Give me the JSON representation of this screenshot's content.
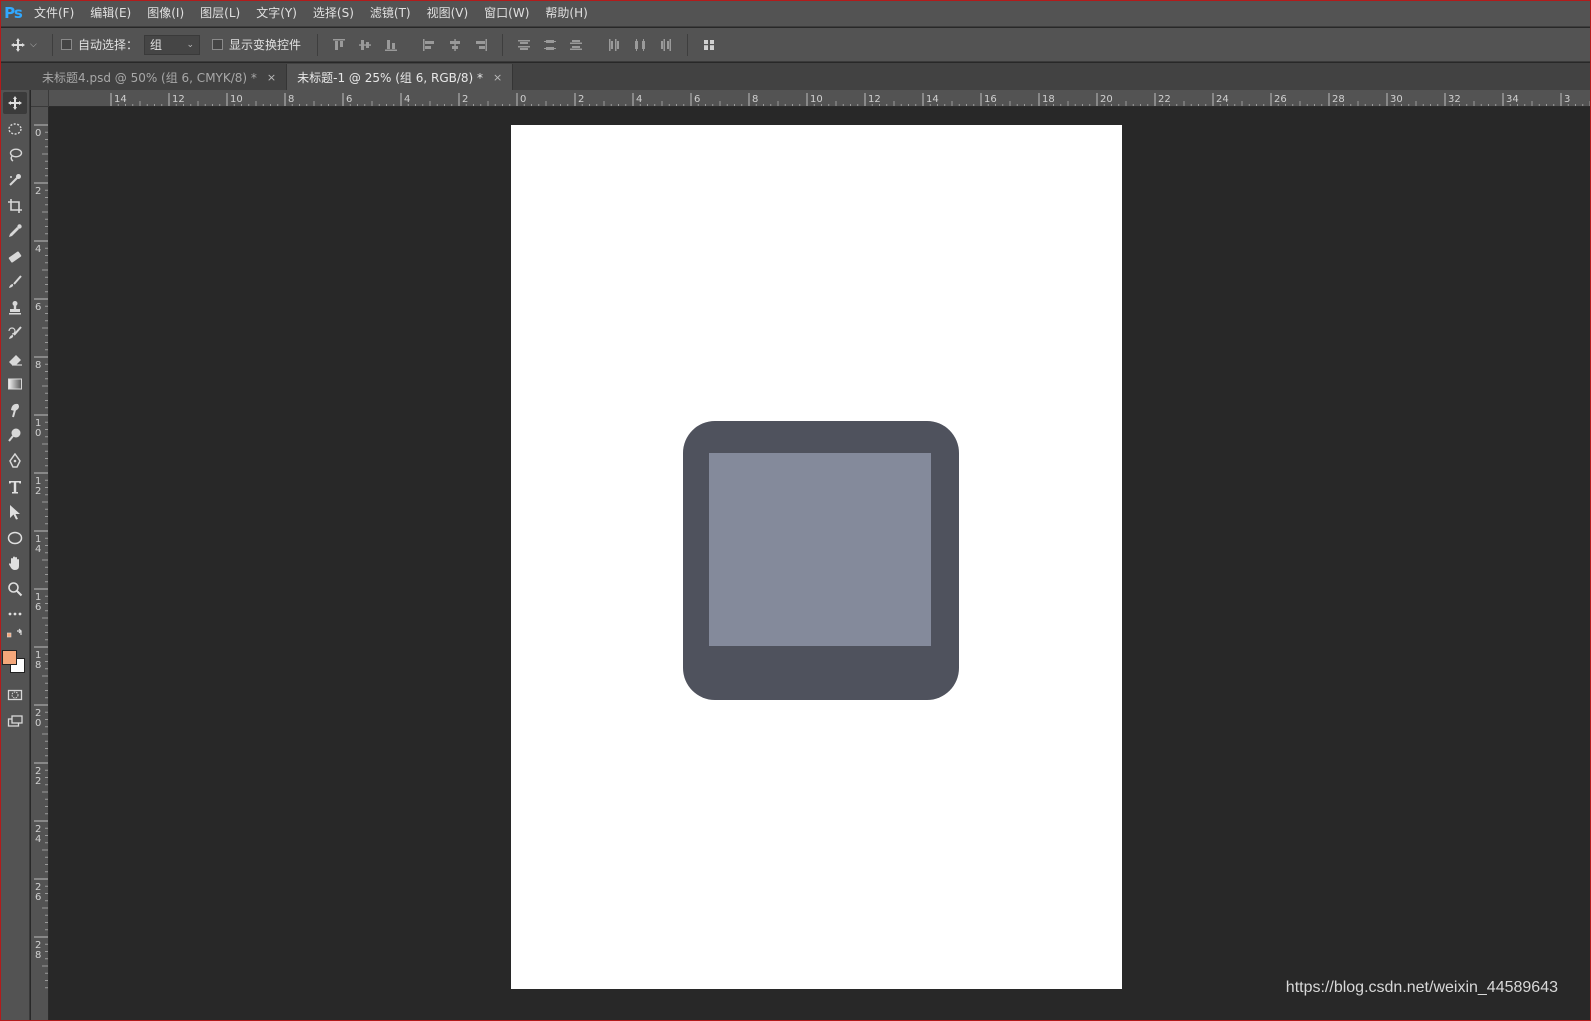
{
  "app": {
    "logo": "Ps"
  },
  "menu": [
    {
      "id": "file",
      "label": "文件(F)"
    },
    {
      "id": "edit",
      "label": "编辑(E)"
    },
    {
      "id": "image",
      "label": "图像(I)"
    },
    {
      "id": "layer",
      "label": "图层(L)"
    },
    {
      "id": "type",
      "label": "文字(Y)"
    },
    {
      "id": "select",
      "label": "选择(S)"
    },
    {
      "id": "filter",
      "label": "滤镜(T)"
    },
    {
      "id": "view",
      "label": "视图(V)"
    },
    {
      "id": "window",
      "label": "窗口(W)"
    },
    {
      "id": "help",
      "label": "帮助(H)"
    }
  ],
  "options": {
    "auto_select_label": "自动选择：",
    "auto_select_checked": false,
    "auto_select_value": "组",
    "show_transform_label": "显示变换控件",
    "show_transform_checked": false
  },
  "tabs": [
    {
      "label": "未标题4.psd @ 50% (组 6, CMYK/8) *",
      "active": false
    },
    {
      "label": "未标题-1 @ 25% (组 6, RGB/8) *",
      "active": true
    }
  ],
  "tab_close_glyph": "×",
  "ruler_h_labels": [
    "14",
    "12",
    "10",
    "8",
    "6",
    "4",
    "2",
    "0",
    "2",
    "4",
    "6",
    "8",
    "10",
    "12",
    "14",
    "16",
    "18",
    "20",
    "22",
    "24",
    "26",
    "28",
    "30",
    "32",
    "34",
    "3"
  ],
  "ruler_v_labels": [
    "0",
    "2",
    "4",
    "6",
    "8",
    "10",
    "12",
    "14",
    "16",
    "18",
    "20",
    "22",
    "24",
    "26",
    "28"
  ],
  "colors": {
    "foreground": "#f5a77a",
    "background": "#ffffff",
    "shape_outer": "#4f525d",
    "shape_inner": "#848a9b"
  },
  "tools": [
    "move-icon",
    "marquee-ellipse-icon",
    "lasso-icon",
    "quick-select-icon",
    "crop-icon",
    "eyedropper-icon",
    "healing-brush-icon",
    "brush-icon",
    "clone-stamp-icon",
    "history-brush-icon",
    "eraser-icon",
    "gradient-icon",
    "smudge-icon",
    "dodge-icon",
    "pen-icon",
    "type-icon",
    "path-select-icon",
    "ellipse-icon",
    "hand-icon",
    "zoom-icon",
    "more-tools-icon"
  ],
  "watermark": "https://blog.csdn.net/weixin_44589643"
}
